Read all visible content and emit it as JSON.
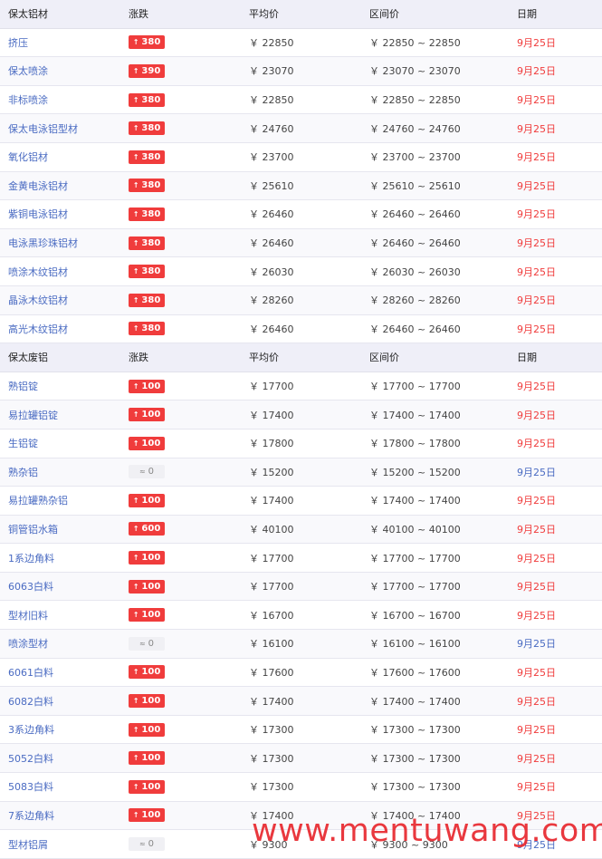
{
  "sections": [
    {
      "header": {
        "name": "保太铝材",
        "change": "涨跌",
        "avg": "平均价",
        "range": "区间价",
        "date": "日期"
      },
      "rows": [
        {
          "name": "挤压",
          "change": "380",
          "direction": "up",
          "avg": "￥ 22850",
          "range": "￥ 22850 ~ 22850",
          "date": "9月25日"
        },
        {
          "name": "保太喷涂",
          "change": "390",
          "direction": "up",
          "avg": "￥ 23070",
          "range": "￥ 23070 ~ 23070",
          "date": "9月25日"
        },
        {
          "name": "非标喷涂",
          "change": "380",
          "direction": "up",
          "avg": "￥ 22850",
          "range": "￥ 22850 ~ 22850",
          "date": "9月25日"
        },
        {
          "name": "保太电泳铝型材",
          "change": "380",
          "direction": "up",
          "avg": "￥ 24760",
          "range": "￥ 24760 ~ 24760",
          "date": "9月25日"
        },
        {
          "name": "氧化铝材",
          "change": "380",
          "direction": "up",
          "avg": "￥ 23700",
          "range": "￥ 23700 ~ 23700",
          "date": "9月25日"
        },
        {
          "name": "金黄电泳铝材",
          "change": "380",
          "direction": "up",
          "avg": "￥ 25610",
          "range": "￥ 25610 ~ 25610",
          "date": "9月25日"
        },
        {
          "name": "紫铜电泳铝材",
          "change": "380",
          "direction": "up",
          "avg": "￥ 26460",
          "range": "￥ 26460 ~ 26460",
          "date": "9月25日"
        },
        {
          "name": "电泳黑珍珠铝材",
          "change": "380",
          "direction": "up",
          "avg": "￥ 26460",
          "range": "￥ 26460 ~ 26460",
          "date": "9月25日"
        },
        {
          "name": "喷涂木纹铝材",
          "change": "380",
          "direction": "up",
          "avg": "￥ 26030",
          "range": "￥ 26030 ~ 26030",
          "date": "9月25日"
        },
        {
          "name": "晶泳木纹铝材",
          "change": "380",
          "direction": "up",
          "avg": "￥ 28260",
          "range": "￥ 28260 ~ 28260",
          "date": "9月25日"
        },
        {
          "name": "高光木纹铝材",
          "change": "380",
          "direction": "up",
          "avg": "￥ 26460",
          "range": "￥ 26460 ~ 26460",
          "date": "9月25日"
        }
      ]
    },
    {
      "header": {
        "name": "保太废铝",
        "change": "涨跌",
        "avg": "平均价",
        "range": "区间价",
        "date": "日期"
      },
      "rows": [
        {
          "name": "熟铝锭",
          "change": "100",
          "direction": "up",
          "avg": "￥ 17700",
          "range": "￥ 17700 ~ 17700",
          "date": "9月25日"
        },
        {
          "name": "易拉罐铝锭",
          "change": "100",
          "direction": "up",
          "avg": "￥ 17400",
          "range": "￥ 17400 ~ 17400",
          "date": "9月25日"
        },
        {
          "name": "生铝锭",
          "change": "100",
          "direction": "up",
          "avg": "￥ 17800",
          "range": "￥ 17800 ~ 17800",
          "date": "9月25日"
        },
        {
          "name": "熟杂铝",
          "change": "0",
          "direction": "flat",
          "avg": "￥ 15200",
          "range": "￥ 15200 ~ 15200",
          "date": "9月25日"
        },
        {
          "name": "易拉罐熟杂铝",
          "change": "100",
          "direction": "up",
          "avg": "￥ 17400",
          "range": "￥ 17400 ~ 17400",
          "date": "9月25日"
        },
        {
          "name": "铜管铝水箱",
          "change": "600",
          "direction": "up",
          "avg": "￥ 40100",
          "range": "￥ 40100 ~ 40100",
          "date": "9月25日"
        },
        {
          "name": "1系边角料",
          "change": "100",
          "direction": "up",
          "avg": "￥ 17700",
          "range": "￥ 17700 ~ 17700",
          "date": "9月25日"
        },
        {
          "name": "6063白料",
          "change": "100",
          "direction": "up",
          "avg": "￥ 17700",
          "range": "￥ 17700 ~ 17700",
          "date": "9月25日"
        },
        {
          "name": "型材旧料",
          "change": "100",
          "direction": "up",
          "avg": "￥ 16700",
          "range": "￥ 16700 ~ 16700",
          "date": "9月25日"
        },
        {
          "name": "喷涂型材",
          "change": "0",
          "direction": "flat",
          "avg": "￥ 16100",
          "range": "￥ 16100 ~ 16100",
          "date": "9月25日"
        },
        {
          "name": "6061白料",
          "change": "100",
          "direction": "up",
          "avg": "￥ 17600",
          "range": "￥ 17600 ~ 17600",
          "date": "9月25日"
        },
        {
          "name": "6082白料",
          "change": "100",
          "direction": "up",
          "avg": "￥ 17400",
          "range": "￥ 17400 ~ 17400",
          "date": "9月25日"
        },
        {
          "name": "3系边角料",
          "change": "100",
          "direction": "up",
          "avg": "￥ 17300",
          "range": "￥ 17300 ~ 17300",
          "date": "9月25日"
        },
        {
          "name": "5052白料",
          "change": "100",
          "direction": "up",
          "avg": "￥ 17300",
          "range": "￥ 17300 ~ 17300",
          "date": "9月25日"
        },
        {
          "name": "5083白料",
          "change": "100",
          "direction": "up",
          "avg": "￥ 17300",
          "range": "￥ 17300 ~ 17300",
          "date": "9月25日"
        },
        {
          "name": "7系边角料",
          "change": "100",
          "direction": "up",
          "avg": "￥ 17400",
          "range": "￥ 17400 ~ 17400",
          "date": "9月25日"
        },
        {
          "name": "型材铝屑",
          "change": "0",
          "direction": "flat",
          "avg": "￥ 9300",
          "range": "￥ 9300 ~ 9300",
          "date": "9月25日"
        }
      ]
    }
  ],
  "icons": {
    "up": "up-arrow-icon",
    "flat": "flat-wave-icon"
  },
  "colors": {
    "up": "#f03c3c",
    "flat_date": "#4a6bc2",
    "name_link": "#4a6bc2",
    "header_bg": "#efeff8"
  },
  "watermark": "www.mentuwang.com"
}
